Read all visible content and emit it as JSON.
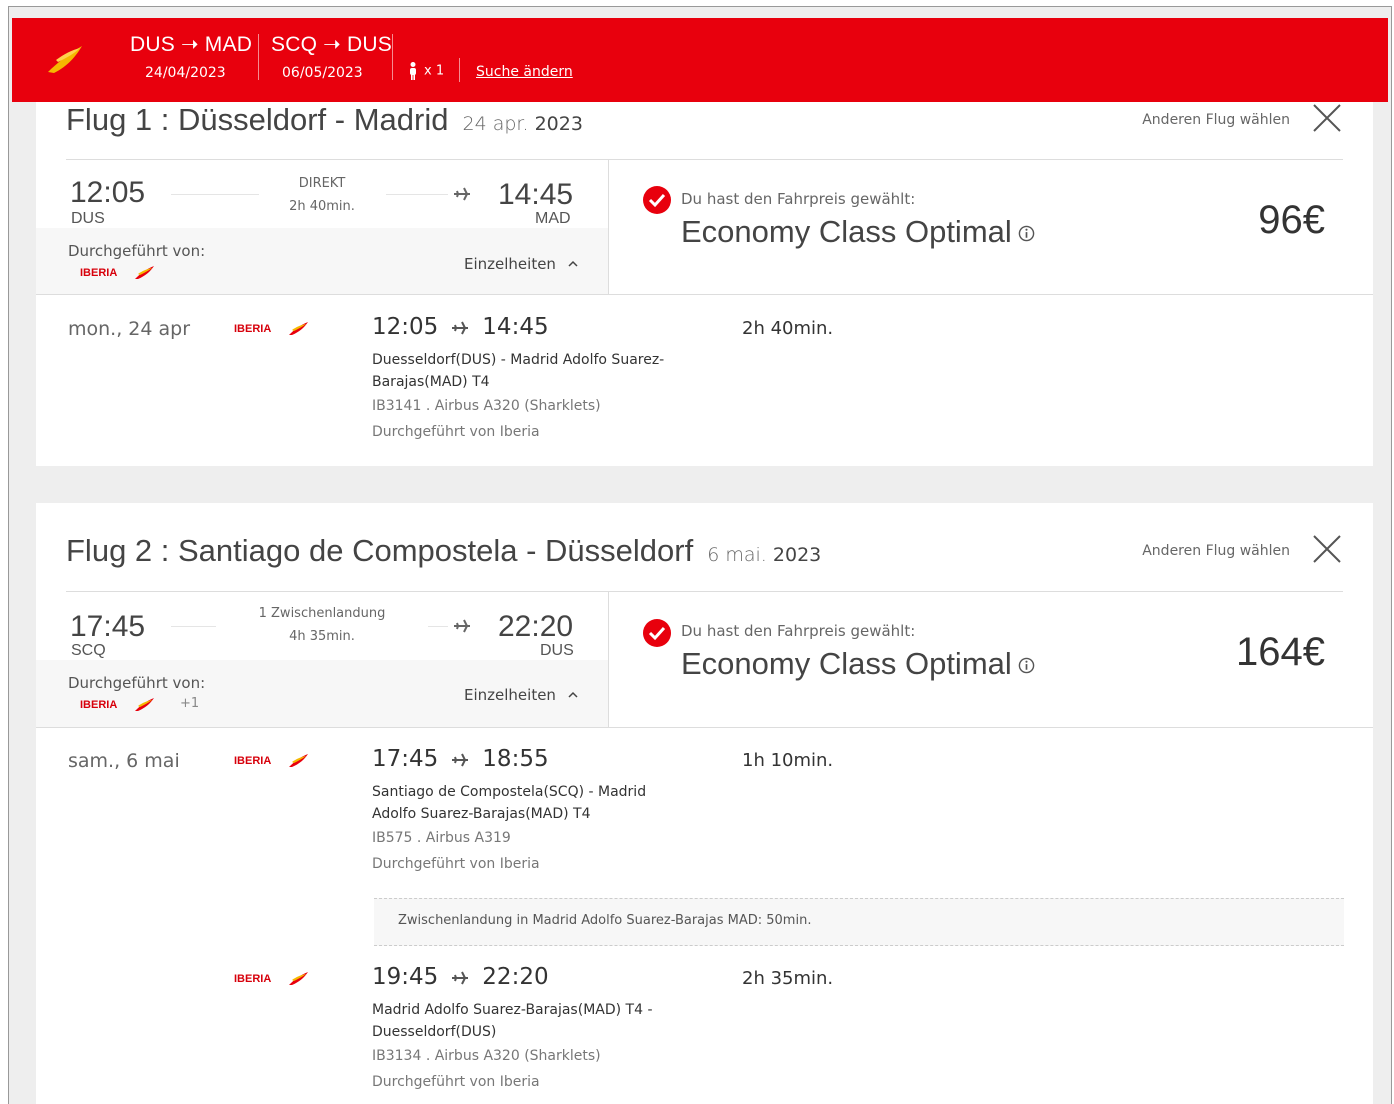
{
  "header": {
    "segments": [
      {
        "route": "DUS ➝ MAD",
        "date": "24/04/2023"
      },
      {
        "route": "SCQ ➝ DUS",
        "date": "06/05/2023"
      }
    ],
    "passengers": "x 1",
    "change_search": "Suche ändern"
  },
  "colors": {
    "brand_red": "#e8000d",
    "brand_yellow": "#f5b800"
  },
  "airline_logo_text": "IBERIA",
  "flight1": {
    "title": "Flug 1 : Düsseldorf - Madrid",
    "date_prefix": "24 apr.",
    "date_year": "2023",
    "other_flight": "Anderen Flug wählen",
    "dep_time": "12:05",
    "dep_code": "DUS",
    "arr_time": "14:45",
    "arr_code": "MAD",
    "stops": "DIREKT",
    "duration": "2h 40min.",
    "operated_by": "Durchgeführt von:",
    "details": "Einzelheiten",
    "chosen": "Du hast den Fahrpreis gewählt:",
    "fare": "Economy Class Optimal",
    "price": "96€",
    "day": "mon., 24 apr",
    "legs": [
      {
        "dep": "12:05",
        "arr": "14:45",
        "duration": "2h 40min.",
        "route": "Duesseldorf(DUS) - Madrid Adolfo Suarez-Barajas(MAD) T4",
        "flight": "IB3141 . Airbus A320 (Sharklets)",
        "operator": "Durchgeführt von Iberia"
      }
    ]
  },
  "flight2": {
    "title": "Flug 2 : Santiago de Compostela - Düsseldorf",
    "date_prefix": "6 mai.",
    "date_year": "2023",
    "other_flight": "Anderen Flug wählen",
    "dep_time": "17:45",
    "dep_code": "SCQ",
    "arr_time": "22:20",
    "arr_code": "DUS",
    "stops": "1 Zwischenlandung",
    "duration": "4h 35min.",
    "operated_by": "Durchgeführt von:",
    "plus": "+1",
    "details": "Einzelheiten",
    "chosen": "Du hast den Fahrpreis gewählt:",
    "fare": "Economy Class Optimal",
    "price": "164€",
    "day": "sam., 6 mai",
    "legs": [
      {
        "dep": "17:45",
        "arr": "18:55",
        "duration": "1h 10min.",
        "route": "Santiago de Compostela(SCQ) - Madrid Adolfo Suarez-Barajas(MAD) T4",
        "flight": "IB575 . Airbus A319",
        "operator": "Durchgeführt von Iberia"
      },
      {
        "dep": "19:45",
        "arr": "22:20",
        "duration": "2h 35min.",
        "route": "Madrid Adolfo Suarez-Barajas(MAD) T4 - Duesseldorf(DUS)",
        "flight": "IB3134 . Airbus A320 (Sharklets)",
        "operator": "Durchgeführt von Iberia"
      }
    ],
    "layover": "Zwischenlandung in Madrid Adolfo Suarez-Barajas MAD: 50min."
  }
}
